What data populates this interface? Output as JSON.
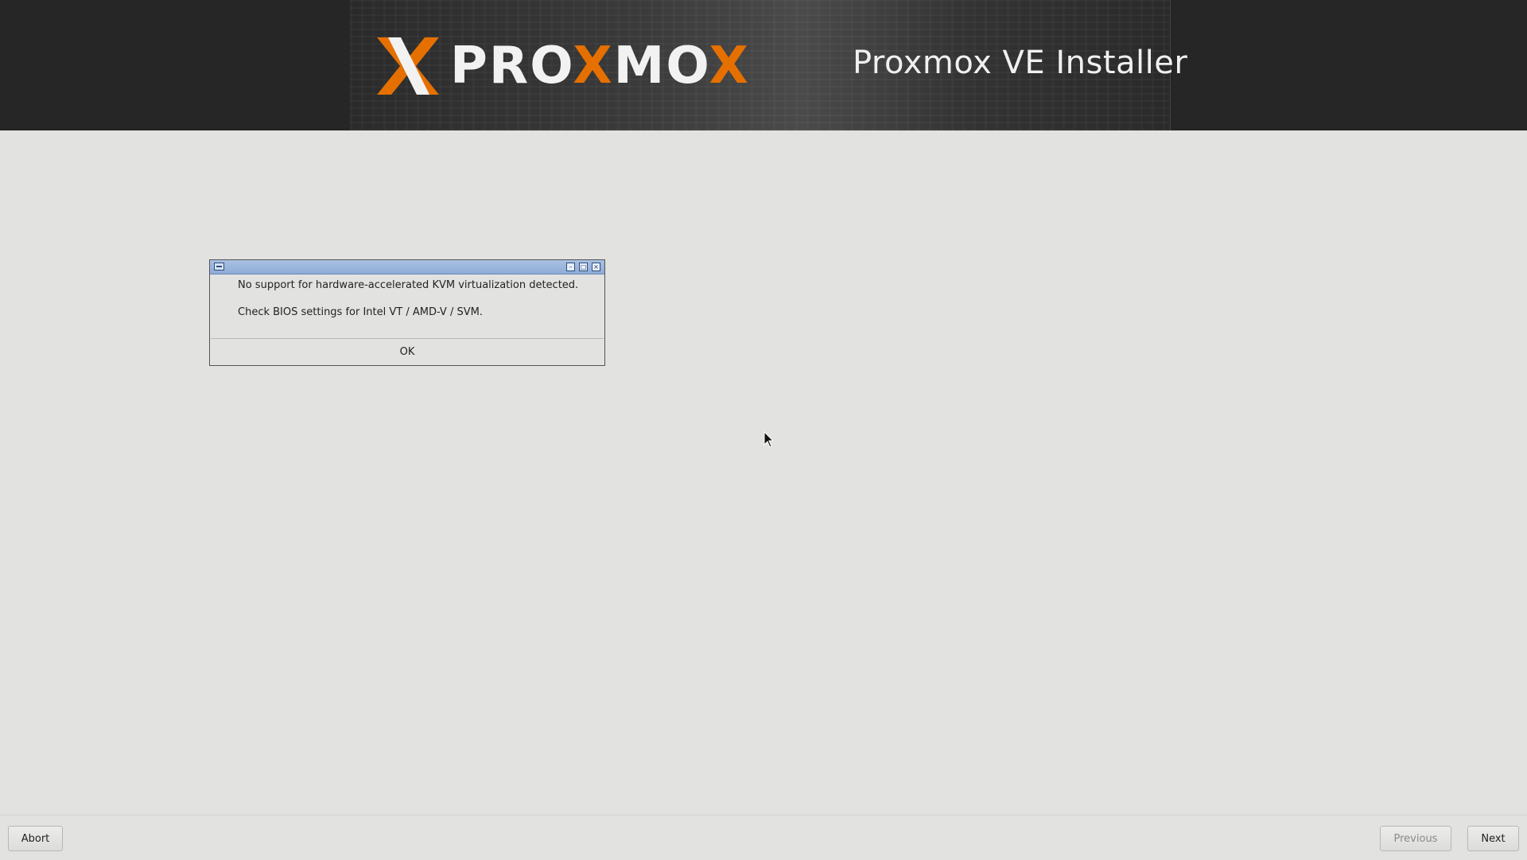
{
  "header": {
    "brand_name_parts": [
      "PRO",
      "X",
      "MO",
      "X"
    ],
    "title": "Proxmox VE Installer"
  },
  "dialog": {
    "message_line_1": "No support for hardware-accelerated KVM virtualization detected.",
    "message_line_2": "Check BIOS settings for Intel VT / AMD-V / SVM.",
    "ok_label": "OK"
  },
  "footer": {
    "abort_label": "Abort",
    "previous_label": "Previous",
    "next_label": "Next"
  },
  "colors": {
    "header_bg": "#262626",
    "accent": "#e57000",
    "page_bg": "#e2e2e0",
    "titlebar": "#8eabd7"
  }
}
